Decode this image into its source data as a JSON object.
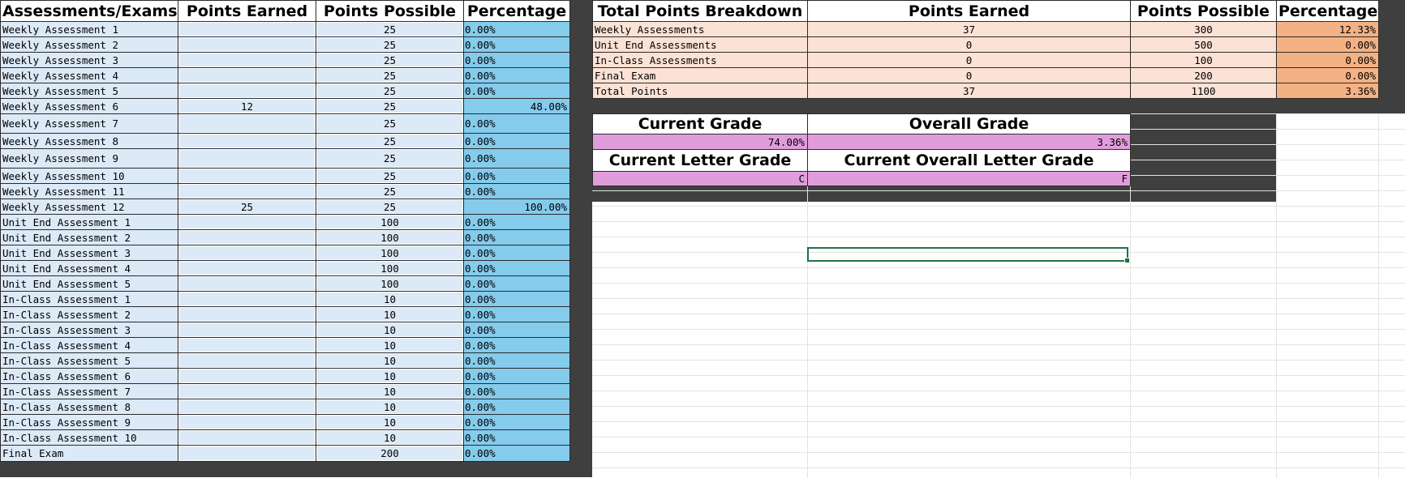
{
  "assessments_table": {
    "headers": {
      "name": "Assessments/Exams",
      "earned": "Points Earned",
      "possible": "Points Possible",
      "percentage": "Percentage"
    },
    "rows": [
      {
        "name": "Weekly Assessment 1",
        "earned": "",
        "possible": "25",
        "percentage": "0.00%"
      },
      {
        "name": "Weekly Assessment 2",
        "earned": "",
        "possible": "25",
        "percentage": "0.00%"
      },
      {
        "name": "Weekly Assessment 3",
        "earned": "",
        "possible": "25",
        "percentage": "0.00%"
      },
      {
        "name": "Weekly Assessment 4",
        "earned": "",
        "possible": "25",
        "percentage": "0.00%"
      },
      {
        "name": "Weekly Assessment 5",
        "earned": "",
        "possible": "25",
        "percentage": "0.00%"
      },
      {
        "name": "Weekly Assessment 6",
        "earned": "12",
        "possible": "25",
        "percentage": "48.00%"
      },
      {
        "name": "Weekly Assessment 7",
        "earned": "",
        "possible": "25",
        "percentage": "0.00%"
      },
      {
        "name": "Weekly Assessment 8",
        "earned": "",
        "possible": "25",
        "percentage": "0.00%"
      },
      {
        "name": "Weekly Assessment 9",
        "earned": "",
        "possible": "25",
        "percentage": "0.00%"
      },
      {
        "name": "Weekly Assessment 10",
        "earned": "",
        "possible": "25",
        "percentage": "0.00%"
      },
      {
        "name": "Weekly Assessment 11",
        "earned": "",
        "possible": "25",
        "percentage": "0.00%"
      },
      {
        "name": "Weekly Assessment 12",
        "earned": "25",
        "possible": "25",
        "percentage": "100.00%"
      },
      {
        "name": "Unit End Assessment 1",
        "earned": "",
        "possible": "100",
        "percentage": "0.00%"
      },
      {
        "name": "Unit End Assessment 2",
        "earned": "",
        "possible": "100",
        "percentage": "0.00%"
      },
      {
        "name": "Unit End Assessment 3",
        "earned": "",
        "possible": "100",
        "percentage": "0.00%"
      },
      {
        "name": "Unit End Assessment 4",
        "earned": "",
        "possible": "100",
        "percentage": "0.00%"
      },
      {
        "name": "Unit End Assessment 5",
        "earned": "",
        "possible": "100",
        "percentage": "0.00%"
      },
      {
        "name": "In-Class Assessment 1",
        "earned": "",
        "possible": "10",
        "percentage": "0.00%"
      },
      {
        "name": "In-Class Assessment 2",
        "earned": "",
        "possible": "10",
        "percentage": "0.00%"
      },
      {
        "name": "In-Class Assessment 3",
        "earned": "",
        "possible": "10",
        "percentage": "0.00%"
      },
      {
        "name": "In-Class Assessment 4",
        "earned": "",
        "possible": "10",
        "percentage": "0.00%"
      },
      {
        "name": "In-Class Assessment 5",
        "earned": "",
        "possible": "10",
        "percentage": "0.00%"
      },
      {
        "name": "In-Class Assessment 6",
        "earned": "",
        "possible": "10",
        "percentage": "0.00%"
      },
      {
        "name": "In-Class Assessment 7",
        "earned": "",
        "possible": "10",
        "percentage": "0.00%"
      },
      {
        "name": "In-Class Assessment 8",
        "earned": "",
        "possible": "10",
        "percentage": "0.00%"
      },
      {
        "name": "In-Class Assessment 9",
        "earned": "",
        "possible": "10",
        "percentage": "0.00%"
      },
      {
        "name": "In-Class Assessment 10",
        "earned": "",
        "possible": "10",
        "percentage": "0.00%"
      },
      {
        "name": "Final Exam",
        "earned": "",
        "possible": "200",
        "percentage": "0.00%"
      }
    ]
  },
  "breakdown_table": {
    "headers": {
      "name": "Total Points Breakdown",
      "earned": "Points Earned",
      "possible": "Points Possible",
      "percentage": "Percentage"
    },
    "rows": [
      {
        "name": "Weekly Assessments",
        "earned": "37",
        "possible": "300",
        "percentage": "12.33%"
      },
      {
        "name": "Unit End Assessments",
        "earned": "0",
        "possible": "500",
        "percentage": "0.00%"
      },
      {
        "name": "In-Class Assessments",
        "earned": "0",
        "possible": "100",
        "percentage": "0.00%"
      },
      {
        "name": "Final Exam",
        "earned": "0",
        "possible": "200",
        "percentage": "0.00%"
      },
      {
        "name": "Total Points",
        "earned": "37",
        "possible": "1100",
        "percentage": "3.36%"
      }
    ]
  },
  "grades": {
    "current_grade_label": "Current Grade",
    "current_grade_value": "74.00%",
    "overall_grade_label": "Overall Grade",
    "overall_grade_value": "3.36%",
    "current_letter_label": "Current Letter Grade",
    "current_letter_value": "C",
    "overall_letter_label": "Current Overall Letter Grade",
    "overall_letter_value": "F"
  },
  "colors": {
    "assessment_cell_fill": "#dce9f7",
    "percentage_fill": "#84cbec",
    "breakdown_fill": "#fbe2d5",
    "breakdown_percentage_fill": "#f4b183",
    "grade_value_fill": "#e19ddb",
    "dark_background": "#3f3f3f",
    "selection_border": "#217346"
  }
}
